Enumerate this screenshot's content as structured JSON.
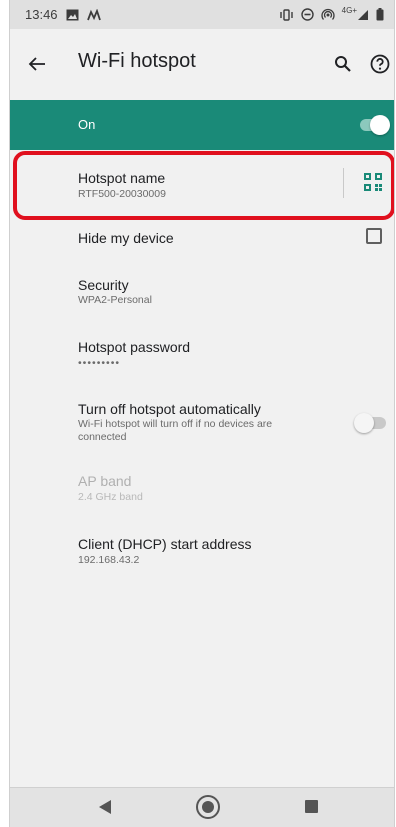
{
  "status_bar": {
    "time": "13:46",
    "left_icons": [
      "image-icon",
      "activity-icon"
    ],
    "right_icons": [
      "vibrate-icon",
      "do-not-disturb-icon",
      "hotspot-icon",
      "signal-icon",
      "battery-icon"
    ],
    "network": "4G+"
  },
  "app_bar": {
    "title": "Wi-Fi hotspot",
    "icons": [
      "back-arrow-icon",
      "search-icon",
      "help-icon"
    ]
  },
  "master_toggle": {
    "label": "On",
    "state": "on",
    "accent_color": "#1a8a78"
  },
  "settings": {
    "hotspot_name": {
      "title": "Hotspot name",
      "value": "RTF500-20030009",
      "icon": "qr-code-icon"
    },
    "hide_device": {
      "title": "Hide my device",
      "checked": false
    },
    "security": {
      "title": "Security",
      "value": "WPA2-Personal"
    },
    "password": {
      "title": "Hotspot password",
      "value": "•••••••••"
    },
    "auto_off": {
      "title": "Turn off hotspot automatically",
      "line1": "Wi-Fi hotspot will turn off if no devices are",
      "line2": "connected",
      "state": "off"
    },
    "ap_band": {
      "title": "AP band",
      "value": "2.4 GHz band",
      "enabled": false
    },
    "dhcp": {
      "title": "Client (DHCP) start address",
      "value": "192.168.43.2"
    }
  },
  "highlight_color": "#e0101e",
  "nav_bar": {
    "buttons": [
      "nav-back-icon",
      "nav-home-icon",
      "nav-recents-icon"
    ]
  }
}
